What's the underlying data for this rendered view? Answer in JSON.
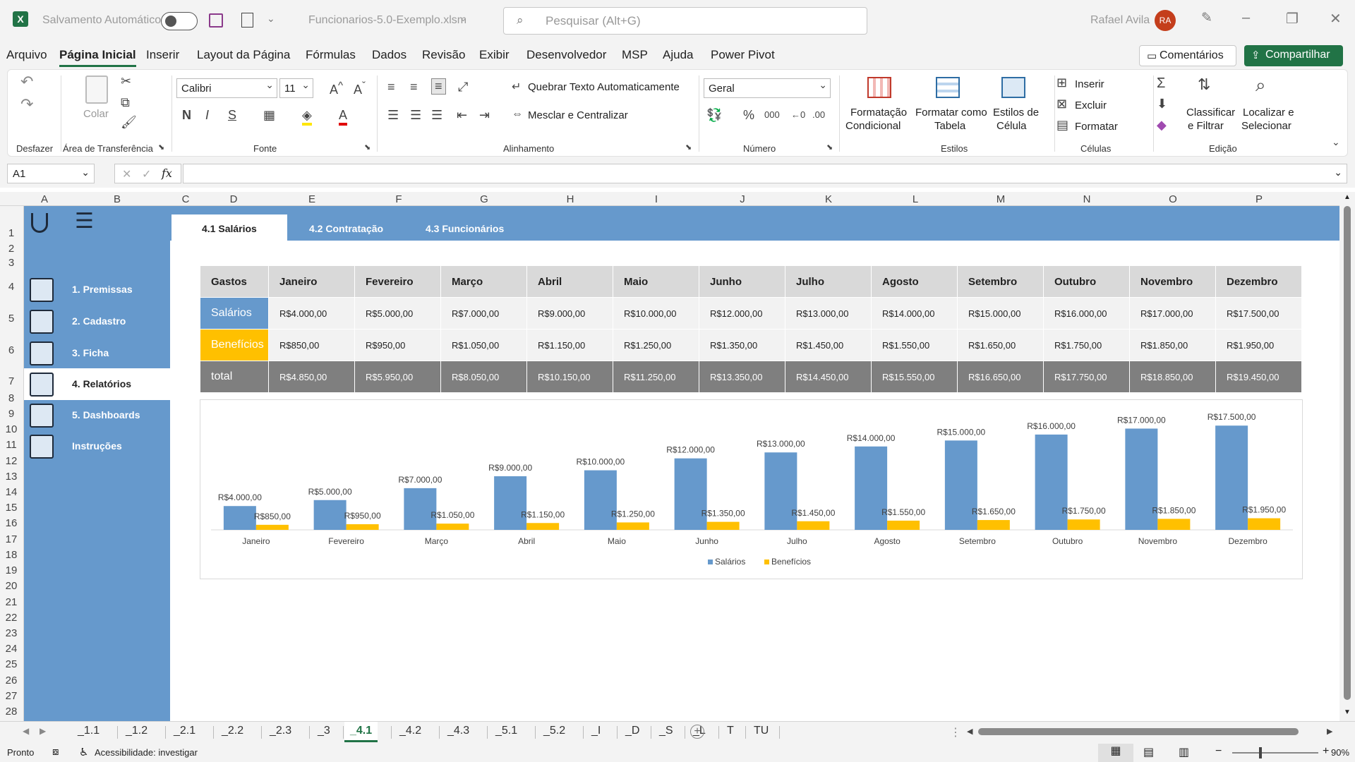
{
  "titlebar": {
    "autosave_label": "Salvamento Automático",
    "filename": "Funcionarios-5.0-Exemplo.xlsm",
    "search_placeholder": "Pesquisar (Alt+G)",
    "user_name": "Rafael Avila",
    "user_initials": "RA"
  },
  "menu": [
    "Arquivo",
    "Página Inicial",
    "Inserir",
    "Layout da Página",
    "Fórmulas",
    "Dados",
    "Revisão",
    "Exibir",
    "Desenvolvedor",
    "MSP",
    "Ajuda",
    "Power Pivot"
  ],
  "menu_active": "Página Inicial",
  "comments_label": "Comentários",
  "share_label": "Compartilhar",
  "ribbon": {
    "undo_group": "Desfazer",
    "paste_label": "Colar",
    "clipboard_group": "Área de Transferência",
    "font_name": "Calibri",
    "font_size": "11",
    "font_group": "Fonte",
    "wrap_text": "Quebrar Texto Automaticamente",
    "merge_center": "Mesclar e Centralizar",
    "alignment_group": "Alinhamento",
    "number_format": "Geral",
    "number_group": "Número",
    "cond_format_1": "Formatação",
    "cond_format_2": "Condicional",
    "format_table_1": "Formatar como",
    "format_table_2": "Tabela",
    "cell_styles_1": "Estilos de",
    "cell_styles_2": "Célula",
    "styles_group": "Estilos",
    "insert": "Inserir",
    "delete": "Excluir",
    "format": "Formatar",
    "cells_group": "Células",
    "sort_filter_1": "Classificar",
    "sort_filter_2": "e Filtrar",
    "find_select_1": "Localizar e",
    "find_select_2": "Selecionar",
    "editing_group": "Edição"
  },
  "namebox": "A1",
  "columns": [
    "A",
    "B",
    "C",
    "D",
    "E",
    "F",
    "G",
    "H",
    "I",
    "J",
    "K",
    "L",
    "M",
    "N",
    "O",
    "P"
  ],
  "rows": [
    "1",
    "2",
    "3",
    "4",
    "5",
    "6",
    "7",
    "8",
    "9",
    "10",
    "11",
    "12",
    "13",
    "14",
    "15",
    "16",
    "17",
    "18",
    "19",
    "20",
    "21",
    "22",
    "23",
    "24",
    "25",
    "26",
    "27",
    "28"
  ],
  "nav": [
    "1. Premissas",
    "2. Cadastro",
    "3. Ficha",
    "4. Relatórios",
    "5. Dashboards",
    "Instruções"
  ],
  "nav_active": "4. Relatórios",
  "tabs": [
    "4.1 Salários",
    "4.2 Contratação",
    "4.3 Funcionários"
  ],
  "table": {
    "header": "Gastos",
    "months": [
      "Janeiro",
      "Fevereiro",
      "Março",
      "Abril",
      "Maio",
      "Junho",
      "Julho",
      "Agosto",
      "Setembro",
      "Outubro",
      "Novembro",
      "Dezembro"
    ],
    "salarios_label": "Salários",
    "salarios": [
      "R$4.000,00",
      "R$5.000,00",
      "R$7.000,00",
      "R$9.000,00",
      "R$10.000,00",
      "R$12.000,00",
      "R$13.000,00",
      "R$14.000,00",
      "R$15.000,00",
      "R$16.000,00",
      "R$17.000,00",
      "R$17.500,00"
    ],
    "beneficios_label": "Benefícios",
    "beneficios": [
      "R$850,00",
      "R$950,00",
      "R$1.050,00",
      "R$1.150,00",
      "R$1.250,00",
      "R$1.350,00",
      "R$1.450,00",
      "R$1.550,00",
      "R$1.650,00",
      "R$1.750,00",
      "R$1.850,00",
      "R$1.950,00"
    ],
    "total_label": "total",
    "total": [
      "R$4.850,00",
      "R$5.950,00",
      "R$8.050,00",
      "R$10.150,00",
      "R$11.250,00",
      "R$13.350,00",
      "R$14.450,00",
      "R$15.550,00",
      "R$16.650,00",
      "R$17.750,00",
      "R$18.850,00",
      "R$19.450,00"
    ]
  },
  "chart_data": {
    "type": "bar",
    "categories": [
      "Janeiro",
      "Fevereiro",
      "Março",
      "Abril",
      "Maio",
      "Junho",
      "Julho",
      "Agosto",
      "Setembro",
      "Outubro",
      "Novembro",
      "Dezembro"
    ],
    "series": [
      {
        "name": "Salários",
        "color": "#6699cc",
        "values": [
          4000,
          5000,
          7000,
          9000,
          10000,
          12000,
          13000,
          14000,
          15000,
          16000,
          17000,
          17500
        ],
        "labels": [
          "R$4.000,00",
          "R$5.000,00",
          "R$7.000,00",
          "R$9.000,00",
          "R$10.000,00",
          "R$12.000,00",
          "R$13.000,00",
          "R$14.000,00",
          "R$15.000,00",
          "R$16.000,00",
          "R$17.000,00",
          "R$17.500,00"
        ]
      },
      {
        "name": "Benefícios",
        "color": "#ffc000",
        "values": [
          850,
          950,
          1050,
          1150,
          1250,
          1350,
          1450,
          1550,
          1650,
          1750,
          1850,
          1950
        ],
        "labels": [
          "R$850,00",
          "R$950,00",
          "R$1.050,00",
          "R$1.150,00",
          "R$1.250,00",
          "R$1.350,00",
          "R$1.450,00",
          "R$1.550,00",
          "R$1.650,00",
          "R$1.750,00",
          "R$1.850,00",
          "R$1.950,00"
        ]
      }
    ],
    "ylim": [
      0,
      18000
    ],
    "legend": "bottom",
    "grid": false
  },
  "sheet_tabs": [
    "_1.1",
    "_1.2",
    "_2.1",
    "_2.2",
    "_2.3",
    "_3",
    "_4.1",
    "_4.2",
    "_4.3",
    "_5.1",
    "_5.2",
    "_I",
    "_D",
    "_S",
    "_L",
    "T",
    "TU"
  ],
  "sheet_active": "_4.1",
  "status": {
    "ready": "Pronto",
    "accessibility": "Acessibilidade: investigar",
    "zoom": "90%"
  }
}
